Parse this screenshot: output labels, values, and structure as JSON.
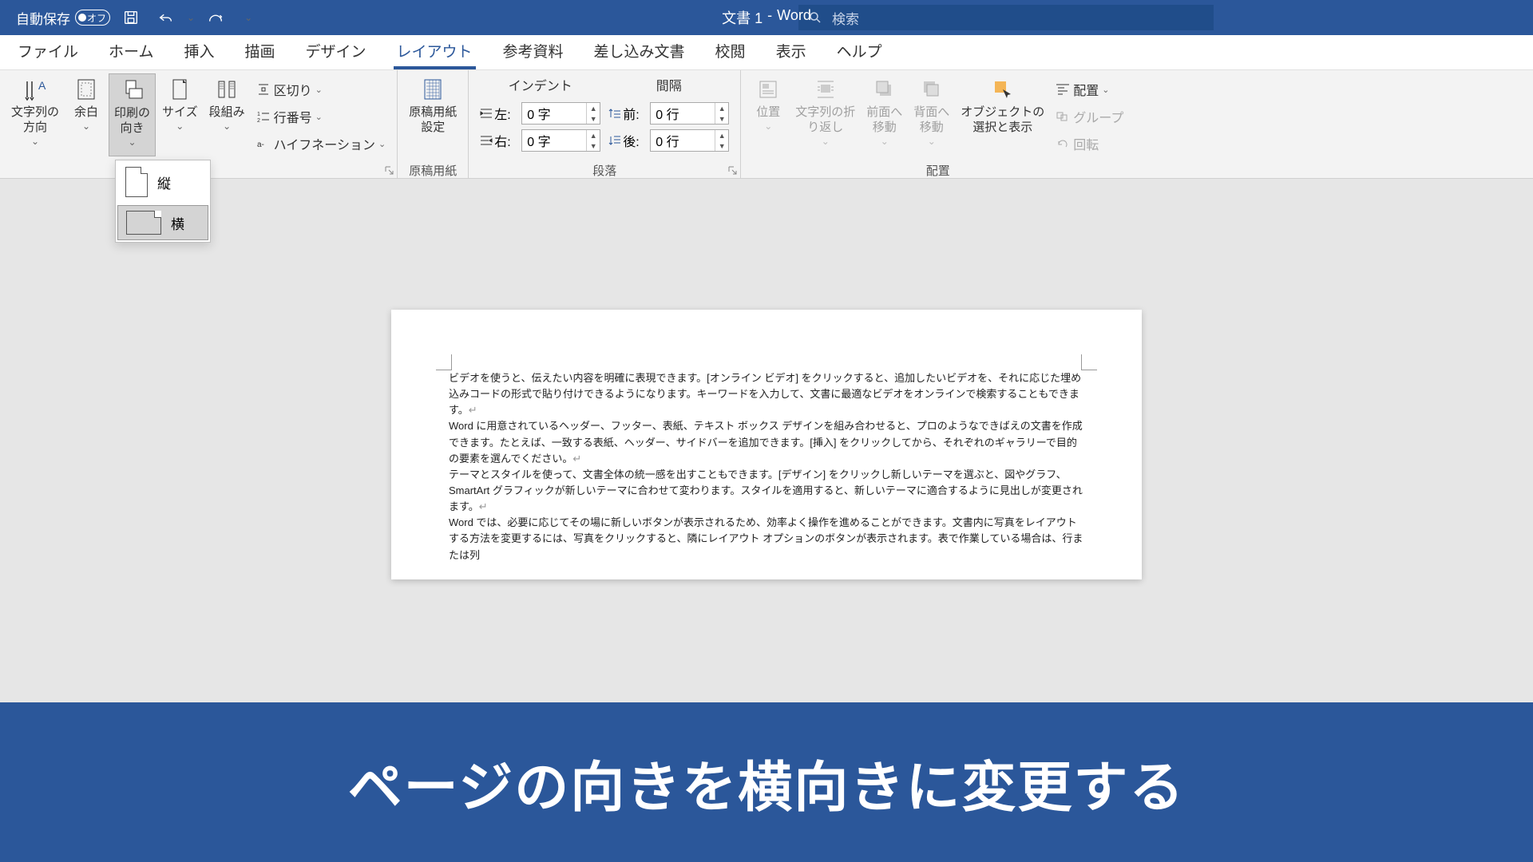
{
  "titlebar": {
    "autosave_label": "自動保存",
    "autosave_state": "オフ",
    "doc_title": "文書 1",
    "app_name": "Word",
    "search_placeholder": "検索"
  },
  "tabs": {
    "file": "ファイル",
    "home": "ホーム",
    "insert": "挿入",
    "draw": "描画",
    "design": "デザイン",
    "layout": "レイアウト",
    "references": "参考資料",
    "mailings": "差し込み文書",
    "review": "校閲",
    "view": "表示",
    "help": "ヘルプ"
  },
  "ribbon": {
    "page_setup": {
      "text_direction": "文字列の\n方向",
      "margins": "余白",
      "orientation": "印刷の\n向き",
      "size": "サイズ",
      "columns": "段組み",
      "breaks": "区切り",
      "line_numbers": "行番号",
      "hyphenation": "ハイフネーション"
    },
    "manuscript": {
      "settings": "原稿用紙\n設定",
      "group": "原稿用紙"
    },
    "paragraph": {
      "indent_header": "インデント",
      "spacing_header": "間隔",
      "left": "左:",
      "right": "右:",
      "before": "前:",
      "after": "後:",
      "left_val": "0 字",
      "right_val": "0 字",
      "before_val": "0 行",
      "after_val": "0 行",
      "group": "段落"
    },
    "arrange": {
      "position": "位置",
      "wrap": "文字列の折\nり返し",
      "bring_forward": "前面へ\n移動",
      "send_backward": "背面へ\n移動",
      "selection_pane": "オブジェクトの\n選択と表示",
      "align": "配置",
      "group_objects": "グループ",
      "rotate": "回転",
      "group": "配置"
    }
  },
  "orientation_menu": {
    "portrait": "縦",
    "landscape": "横"
  },
  "document": {
    "p1": "ビデオを使うと、伝えたい内容を明確に表現できます。[オンライン ビデオ] をクリックすると、追加したいビデオを、それに応じた埋め込みコードの形式で貼り付けできるようになります。キーワードを入力して、文書に最適なビデオをオンラインで検索することもできます。",
    "p2": "Word に用意されているヘッダー、フッター、表紙、テキスト ボックス デザインを組み合わせると、プロのようなできばえの文書を作成できます。たとえば、一致する表紙、ヘッダー、サイドバーを追加できます。[挿入] をクリックしてから、それぞれのギャラリーで目的の要素を選んでください。",
    "p3": "テーマとスタイルを使って、文書全体の統一感を出すこともできます。[デザイン] をクリックし新しいテーマを選ぶと、図やグラフ、SmartArt グラフィックが新しいテーマに合わせて変わります。スタイルを適用すると、新しいテーマに適合するように見出しが変更されます。",
    "p4": "Word では、必要に応じてその場に新しいボタンが表示されるため、効率よく操作を進めることができます。文書内に写真をレイアウトする方法を変更するには、写真をクリックすると、隣にレイアウト オプションのボタンが表示されます。表で作業している場合は、行または列"
  },
  "banner": "ページの向きを横向きに変更する"
}
